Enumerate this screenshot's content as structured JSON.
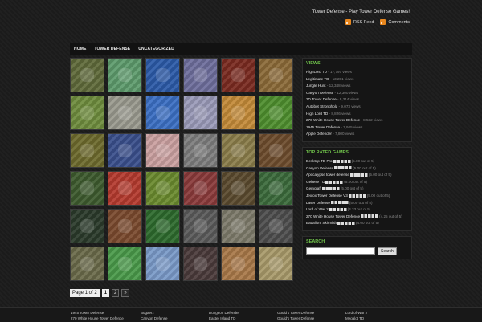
{
  "header": {
    "tagline": "Tower Defense - Play Tower Defense Games!",
    "feeds": [
      {
        "label": "RSS Feed"
      },
      {
        "label": "Comments"
      }
    ]
  },
  "nav": [
    "HOME",
    "TOWER DEFENSE",
    "UNCATEGORIZED"
  ],
  "thumb_colors": [
    "#5f6a3a",
    "#5d9b6c",
    "#2b5aa8",
    "#6e6e9c",
    "#7a2a20",
    "#8b6a38",
    "#6e8c3d",
    "#9a9a8e",
    "#3b6fc4",
    "#9a9ab8",
    "#c38a38",
    "#4e8e2e",
    "#6d6a2d",
    "#3a4f8c",
    "#caa0a0",
    "#7d7d7d",
    "#8a7d4a",
    "#6d4c2d",
    "#3d5a2e",
    "#b43a2e",
    "#6a8a2e",
    "#8a3a3a",
    "#5a4a2e",
    "#3b6a3b",
    "#2a3a2a",
    "#7a4a2e",
    "#2d6a2d",
    "#5a5a5a",
    "#7d7a6a",
    "#4d4d4d",
    "#6a6a4a",
    "#4a9a4a",
    "#7a9ac8",
    "#4a3a3a",
    "#a87848",
    "#a89a6a"
  ],
  "pagination": {
    "label": "Page 1 of 2",
    "current": "1",
    "next_page": "2",
    "next_arrow": "»"
  },
  "sidebar": {
    "views": {
      "title": "VIEWS",
      "items": [
        {
          "name": "HighLord TD",
          "meta": "- 17,797 views"
        },
        {
          "name": "Legitimate TD",
          "meta": "- 13,281 views"
        },
        {
          "name": "Jungle Hunt",
          "meta": "- 12,348 views"
        },
        {
          "name": "Canyon Defense",
          "meta": "- 12,300 views"
        },
        {
          "name": "3D Tower Defense",
          "meta": "- 9,314 views"
        },
        {
          "name": "Autobot Stronghold",
          "meta": "- 9,073 views"
        },
        {
          "name": "High Lord TD",
          "meta": "- 8,826 views"
        },
        {
          "name": "270 White House Tower Defence",
          "meta": "- 8,532 views"
        },
        {
          "name": "1945 Tower Defense",
          "meta": "- 7,945 views"
        },
        {
          "name": "Apple Defender",
          "meta": "- 7,800 views"
        }
      ]
    },
    "top_rated": {
      "title": "TOP RATED GAMES",
      "items": [
        {
          "name": "Desktop TD Pro",
          "meta": "(5.00 out of 5)"
        },
        {
          "name": "Canyon Defense",
          "meta": "(5.00 out of 5)"
        },
        {
          "name": "Apocalypse tower defense",
          "meta": "(5.00 out of 5)"
        },
        {
          "name": "Gehese TD",
          "meta": "(5.00 out of 5)"
        },
        {
          "name": "Gemcraft",
          "meta": "(5.00 out of 5)"
        },
        {
          "name": "Jexlox Tower Defense V3",
          "meta": "(5.00 out of 5)"
        },
        {
          "name": "Laser Defense",
          "meta": "(5.00 out of 5)"
        },
        {
          "name": "Lord of War 2",
          "meta": "(4.33 out of 5)"
        },
        {
          "name": "270 White House Tower Defence",
          "meta": "(4.25 out of 5)"
        },
        {
          "name": "Battalion: Skirmish",
          "meta": "(4.00 out of 5)"
        }
      ]
    },
    "search": {
      "title": "SEARCH",
      "placeholder": "",
      "button": "Search"
    }
  },
  "footer": {
    "columns": [
      [
        "1945 Tower Defense",
        "270 White House Tower Defence"
      ],
      [
        "Bugaerz",
        "Canyon Defense"
      ],
      [
        "Dungeon Defender",
        "Easter Island TD"
      ],
      [
        "Gould's Tower Defense",
        "Gould's Tower Defense"
      ],
      [
        "Lord of War 2",
        "Megalot TD"
      ]
    ]
  }
}
